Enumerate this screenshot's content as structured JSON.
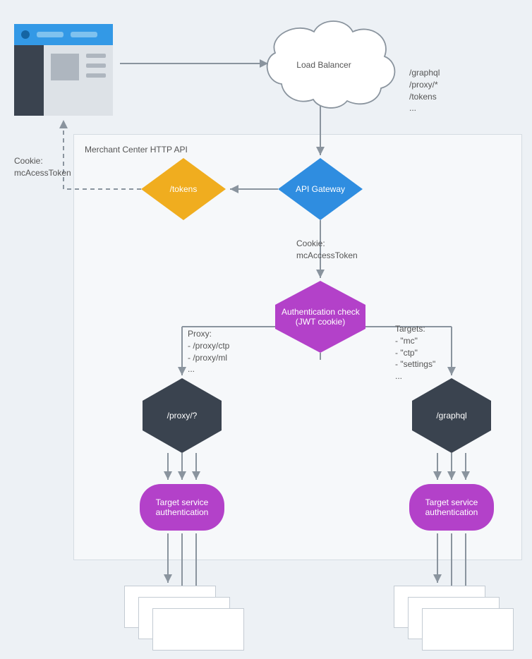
{
  "browser": {
    "cookie_label": "Cookie:\nmcAcessToken"
  },
  "load_balancer": {
    "label": "Load Balancer",
    "endpoints": "/graphql\n/proxy/*\n/tokens\n..."
  },
  "container": {
    "title": "Merchant Center HTTP API"
  },
  "tokens_diamond": {
    "label": "/tokens"
  },
  "gateway_diamond": {
    "label": "API Gateway"
  },
  "cookie_mid": {
    "label": "Cookie:\nmcAccessToken"
  },
  "auth_hex": {
    "label": "Authentication check\n(JWT cookie)"
  },
  "proxy_branch": {
    "note": "Proxy:\n- /proxy/ctp\n- /proxy/ml\n...",
    "hex": "/proxy/?",
    "pill": "Target service\nauthentication"
  },
  "graphql_branch": {
    "note": "Targets:\n- \"mc\"\n- \"ctp\"\n- \"settings\"\n...",
    "hex": "/graphql",
    "pill": "Target service\nauthentication"
  }
}
